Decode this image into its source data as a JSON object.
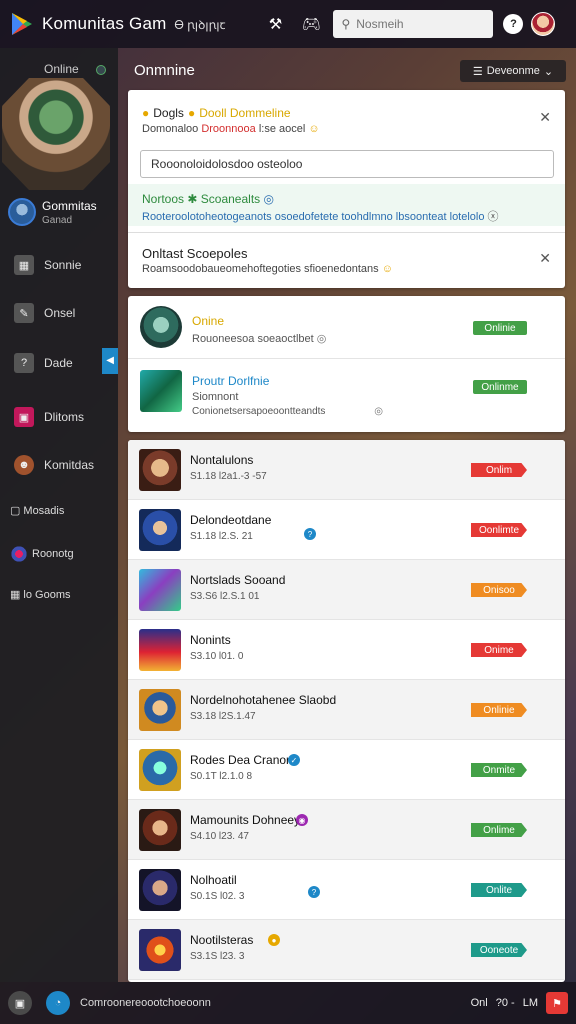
{
  "topbar": {
    "title": "Komunitas Gam",
    "subtitle": "Ꮎ ꞃꞁꝺꞁꞃꞁꞇ",
    "search_placeholder": "Nosmeih",
    "icons": [
      "logo-icon",
      "tools-icon",
      "gamepad-icon",
      "search-icon",
      "help-icon",
      "avatar"
    ]
  },
  "sidebar": {
    "online_label": "Online",
    "profile_name": "Gommitas",
    "profile_sub": "Ganad",
    "items": [
      {
        "label": "Sonnie",
        "icon": "grid-icon"
      },
      {
        "label": "Onsel",
        "icon": "wrench-icon"
      },
      {
        "label": "Dade",
        "icon": "chat-icon"
      },
      {
        "label": "Dlitoms",
        "icon": "gallery-icon"
      },
      {
        "label": "Komitdas",
        "icon": "heroes-icon"
      }
    ],
    "small_items": [
      {
        "label": "Mosadis"
      },
      {
        "label": "Roonotg"
      },
      {
        "label": "lo Gooms"
      }
    ]
  },
  "main": {
    "title": "Onmnine",
    "action_label": "Deveonme",
    "notification": {
      "title_a": "Dogls",
      "title_b": "Dooll Dommeline",
      "sub_a": "Domonaloo",
      "sub_b": "Droonnooa",
      "sub_c": "l:se aocel",
      "input_value": "Rooonoloidolosdoo osteoloo",
      "green_title": "Nortoos",
      "green_title_b": "Scoanealts",
      "green_sub": "Rooteroolotoheotogeanots osoedofetete toohdlmno lbsoonteat lotelolo",
      "title2": "Onltast Scoepoles",
      "sub2": "Roamsoodobaueomehoftegoties sfioenedontans"
    },
    "status": [
      {
        "name": "Onine",
        "sub": "Rouoneesoa soeaoctlbet",
        "badge": "Onlinie",
        "name_color": "#d8a800"
      },
      {
        "name": "Proutr Dorlfnie",
        "sub": "Siomnont",
        "sub2": "Conionetsersapoeoontteandts",
        "badge": "Onlinme",
        "name_color": "#1e88c8"
      }
    ],
    "games": [
      {
        "name": "Nontalulons",
        "meta": "S1.18 l2a1.-3 -57",
        "badge": "Onlim",
        "badge_color": "#e53935"
      },
      {
        "name": "Delondeotdane",
        "meta": "S1.18 l2.S. 21",
        "badge": "Oonlimte",
        "badge_color": "#e53935"
      },
      {
        "name": "Nortslads Sooand",
        "meta": "S3.S6 l2.S.1 01",
        "badge": "Onisoo",
        "badge_color": "#ef8c22"
      },
      {
        "name": "Nonints",
        "meta": "S3.10 l01. 0",
        "badge": "Onime",
        "badge_color": "#e53935"
      },
      {
        "name": "Nordelnohotahenee Slaobd",
        "meta": "S3.18 l2S.1.47",
        "badge": "Onlinie",
        "badge_color": "#ef8c22"
      },
      {
        "name": "Rodes Dea Cranors",
        "meta": "S0.1T l2.1.0 8",
        "badge": "Onmite",
        "badge_color": "#43a047"
      },
      {
        "name": "Mamounits Dohneey",
        "meta": "S4.10 l23. 47",
        "badge": "Onlime",
        "badge_color": "#43a047"
      },
      {
        "name": "Nolhoatil",
        "meta": "S0.1S l02. 3",
        "badge": "Onlite",
        "badge_color": "#1e9a8a"
      },
      {
        "name": "Nootilsteras",
        "meta": "S3.1S l23. 3",
        "badge": "Ooneote",
        "badge_color": "#1e9a8a"
      }
    ]
  },
  "bottombar": {
    "text": "Comroonereoootchoeoonn",
    "right_a": "Onl",
    "right_b": "?0 -",
    "right_c": "LM"
  }
}
